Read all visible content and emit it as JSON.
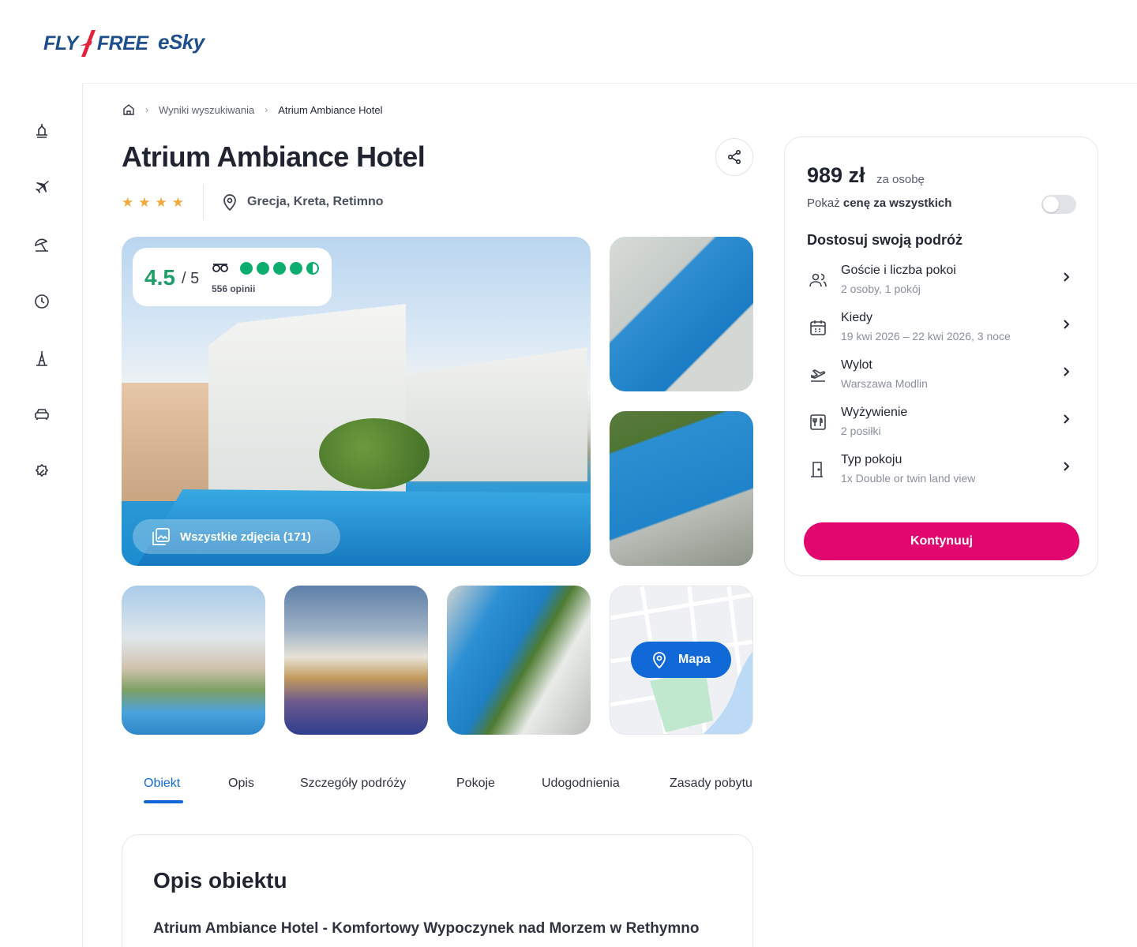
{
  "brand": {
    "logo_left": "FLY FREE",
    "logo_left_part1": "FLY",
    "logo_left_part2": "FREE",
    "logo_right": "eSky",
    "primary_color": "#1e4e8c",
    "accent_color": "#e2066f",
    "link_color": "#1169d8"
  },
  "sidebar": {
    "items": [
      {
        "icon": "beach-vacation-icon"
      },
      {
        "icon": "plane-icon"
      },
      {
        "icon": "sun-umbrella-icon"
      },
      {
        "icon": "clock-icon"
      },
      {
        "icon": "tower-icon"
      },
      {
        "icon": "car-icon"
      },
      {
        "icon": "discount-badge-icon"
      }
    ]
  },
  "breadcrumb": {
    "home_icon": "home-icon",
    "items": [
      "Wyniki wyszukiwania",
      "Atrium Ambiance Hotel"
    ]
  },
  "hotel": {
    "name": "Atrium Ambiance Hotel",
    "stars": 4,
    "location": "Grecja, Kreta, Retimno"
  },
  "rating": {
    "score": "4.5",
    "scale": "/ 5",
    "tripadvisor_bubbles": 4.5,
    "reviews": "556 opinii"
  },
  "gallery": {
    "all_photos_label": "Wszystkie zdjęcia (171)",
    "map_label": "Mapa"
  },
  "tabs": [
    "Obiekt",
    "Opis",
    "Szczegóły podróży",
    "Pokoje",
    "Udogodnienia",
    "Zasady pobytu"
  ],
  "active_tab": "Obiekt",
  "description": {
    "title": "Opis obiektu",
    "subtitle": "Atrium Ambiance Hotel - Komfortowy Wypoczynek nad Morzem w Rethymno"
  },
  "booking": {
    "price": "989 zł",
    "per_person": "za osobę",
    "show_all_prefix": "Pokaż ",
    "show_all_bold": "cenę za wszystkich",
    "toggle_on": false,
    "customize_title": "Dostosuj swoją podróż",
    "options": [
      {
        "icon": "guests-icon",
        "label": "Goście i liczba pokoi",
        "value": "2 osoby, 1 pokój"
      },
      {
        "icon": "calendar-icon",
        "label": "Kiedy",
        "value": "19 kwi 2026 – 22 kwi 2026, 3 noce"
      },
      {
        "icon": "departure-icon",
        "label": "Wylot",
        "value": "Warszawa Modlin"
      },
      {
        "icon": "meals-icon",
        "label": "Wyżywienie",
        "value": "2 posiłki"
      },
      {
        "icon": "room-door-icon",
        "label": "Typ pokoju",
        "value": "1x Double or twin land view"
      }
    ],
    "continue_label": "Kontynuuj"
  }
}
